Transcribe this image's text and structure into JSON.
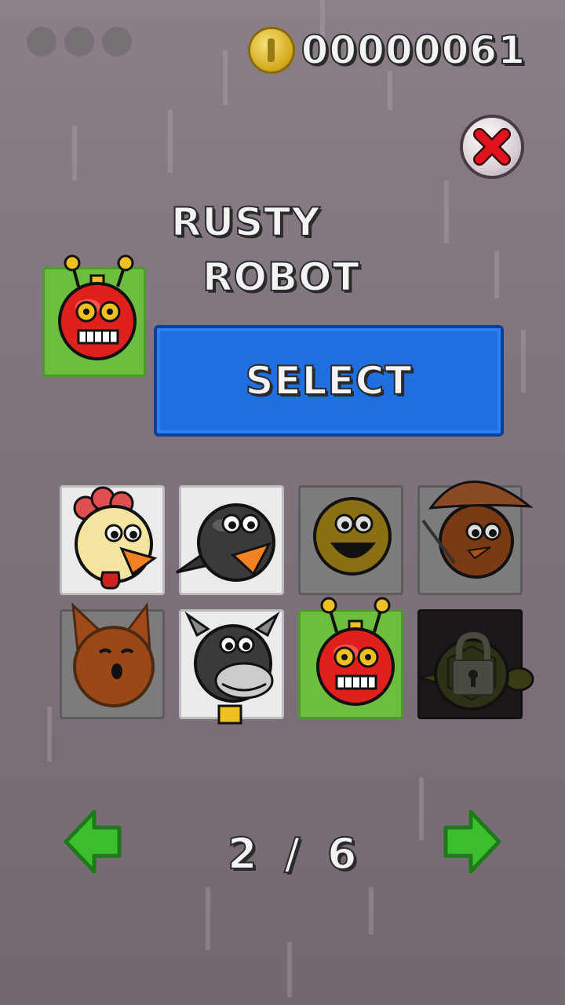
{
  "hud": {
    "coin_count": "00000061",
    "coin_icon": "gold-coin-icon",
    "progress_dots": 3
  },
  "close_button": {
    "icon": "red-x-icon"
  },
  "character": {
    "name_line1": "RUSTY",
    "name_line2": "ROBOT",
    "portrait": "rusty-robot"
  },
  "select_button": {
    "label": "SELECT"
  },
  "characters": [
    {
      "id": "chicken",
      "state": "unlocked"
    },
    {
      "id": "penguin",
      "state": "unlocked"
    },
    {
      "id": "smiley",
      "state": "dimmed"
    },
    {
      "id": "farmer",
      "state": "dimmed"
    },
    {
      "id": "fox",
      "state": "dimmed"
    },
    {
      "id": "cow",
      "state": "unlocked"
    },
    {
      "id": "rusty-robot",
      "state": "selected"
    },
    {
      "id": "turtle",
      "state": "locked"
    }
  ],
  "pagination": {
    "current": "2",
    "separator": "/",
    "total": "6",
    "prev_icon": "green-left-arrow-icon",
    "next_icon": "green-right-arrow-icon"
  },
  "colors": {
    "select_blue": "#1f6fe0",
    "selected_green": "#6cbe3e",
    "arrow_green": "#3cbf2c",
    "close_red": "#e0141e"
  }
}
